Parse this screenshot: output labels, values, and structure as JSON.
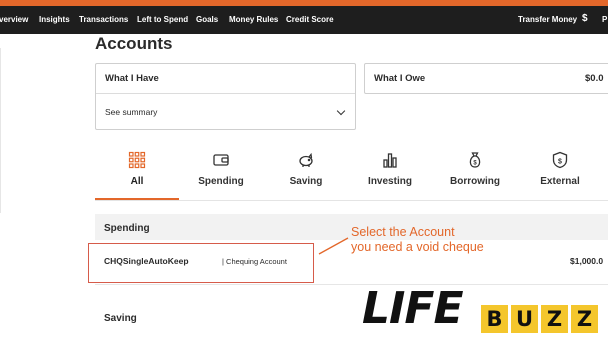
{
  "nav": {
    "items": [
      "verview",
      "Insights",
      "Transactions",
      "Left to Spend",
      "Goals",
      "Money Rules",
      "Credit Score"
    ],
    "transfer": "Transfer Money",
    "dollar": "$",
    "cut_item": "P"
  },
  "page": {
    "title": "Accounts"
  },
  "summary": {
    "have_title": "What I Have",
    "see_summary": "See summary",
    "owe_title": "What I Owe",
    "owe_amount": "$0.0"
  },
  "tabs": [
    {
      "label": "All",
      "icon": "grid-icon",
      "active": true
    },
    {
      "label": "Spending",
      "icon": "wallet-icon"
    },
    {
      "label": "Saving",
      "icon": "piggy-bank-icon"
    },
    {
      "label": "Investing",
      "icon": "bar-chart-icon"
    },
    {
      "label": "Borrowing",
      "icon": "money-bag-icon"
    },
    {
      "label": "External",
      "icon": "shield-dollar-icon"
    }
  ],
  "sections": {
    "spending_title": "Spending",
    "saving_title": "Saving"
  },
  "account": {
    "name": "CHQSingleAutoKeep",
    "type": "| Chequing Account",
    "amount": "$1,000.0"
  },
  "annotation": {
    "line1": "Select the Account",
    "line2": "you need a void cheque"
  },
  "watermark": {
    "life": "LIFE",
    "buzz": [
      "B",
      "U",
      "Z",
      "Z"
    ]
  },
  "colors": {
    "accent": "#e3672a",
    "nav_bg": "#1e1e1e",
    "highlight": "#d65b4a",
    "logo_yellow": "#f4c62c"
  }
}
